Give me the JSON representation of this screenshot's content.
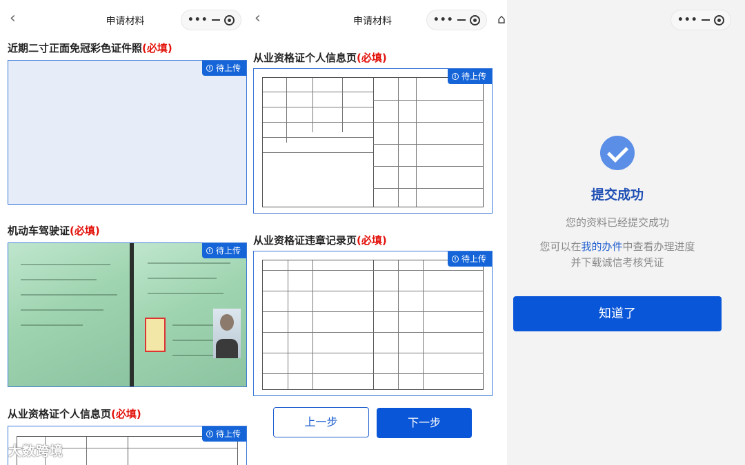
{
  "screen1": {
    "nav": {
      "back": "‹",
      "title": "申请材料"
    },
    "sections": [
      {
        "label": "近期二寸正面免冠彩色证件照",
        "required": "(必填)",
        "badge": "待上传"
      },
      {
        "label": "机动车驾驶证",
        "required": "(必填)",
        "badge": "待上传"
      },
      {
        "label": "从业资格证个人信息页",
        "required": "(必填)",
        "badge": "待上传"
      }
    ]
  },
  "screen2": {
    "nav": {
      "back": "‹",
      "title": "申请材料"
    },
    "sections": [
      {
        "label": "从业资格证个人信息页",
        "required": "(必填)",
        "badge": "待上传"
      },
      {
        "label": "从业资格证违章记录页",
        "required": "(必填)",
        "badge": "待上传"
      }
    ],
    "buttons": {
      "prev": "上一步",
      "next": "下一步"
    }
  },
  "screen3": {
    "title": "提交成功",
    "desc1": "您的资料已经提交成功",
    "desc2_pre": "您可以在",
    "desc2_link": "我的办件",
    "desc2_post": "中查看办理进度",
    "desc3": "并下载诚信考核凭证",
    "ok_button": "知道了"
  },
  "capsule": {
    "more": "•••"
  },
  "watermark": "大数跨境",
  "colors": {
    "primary": "#0a56d8",
    "required": "#e3120b",
    "success": "#5b8ee6"
  }
}
